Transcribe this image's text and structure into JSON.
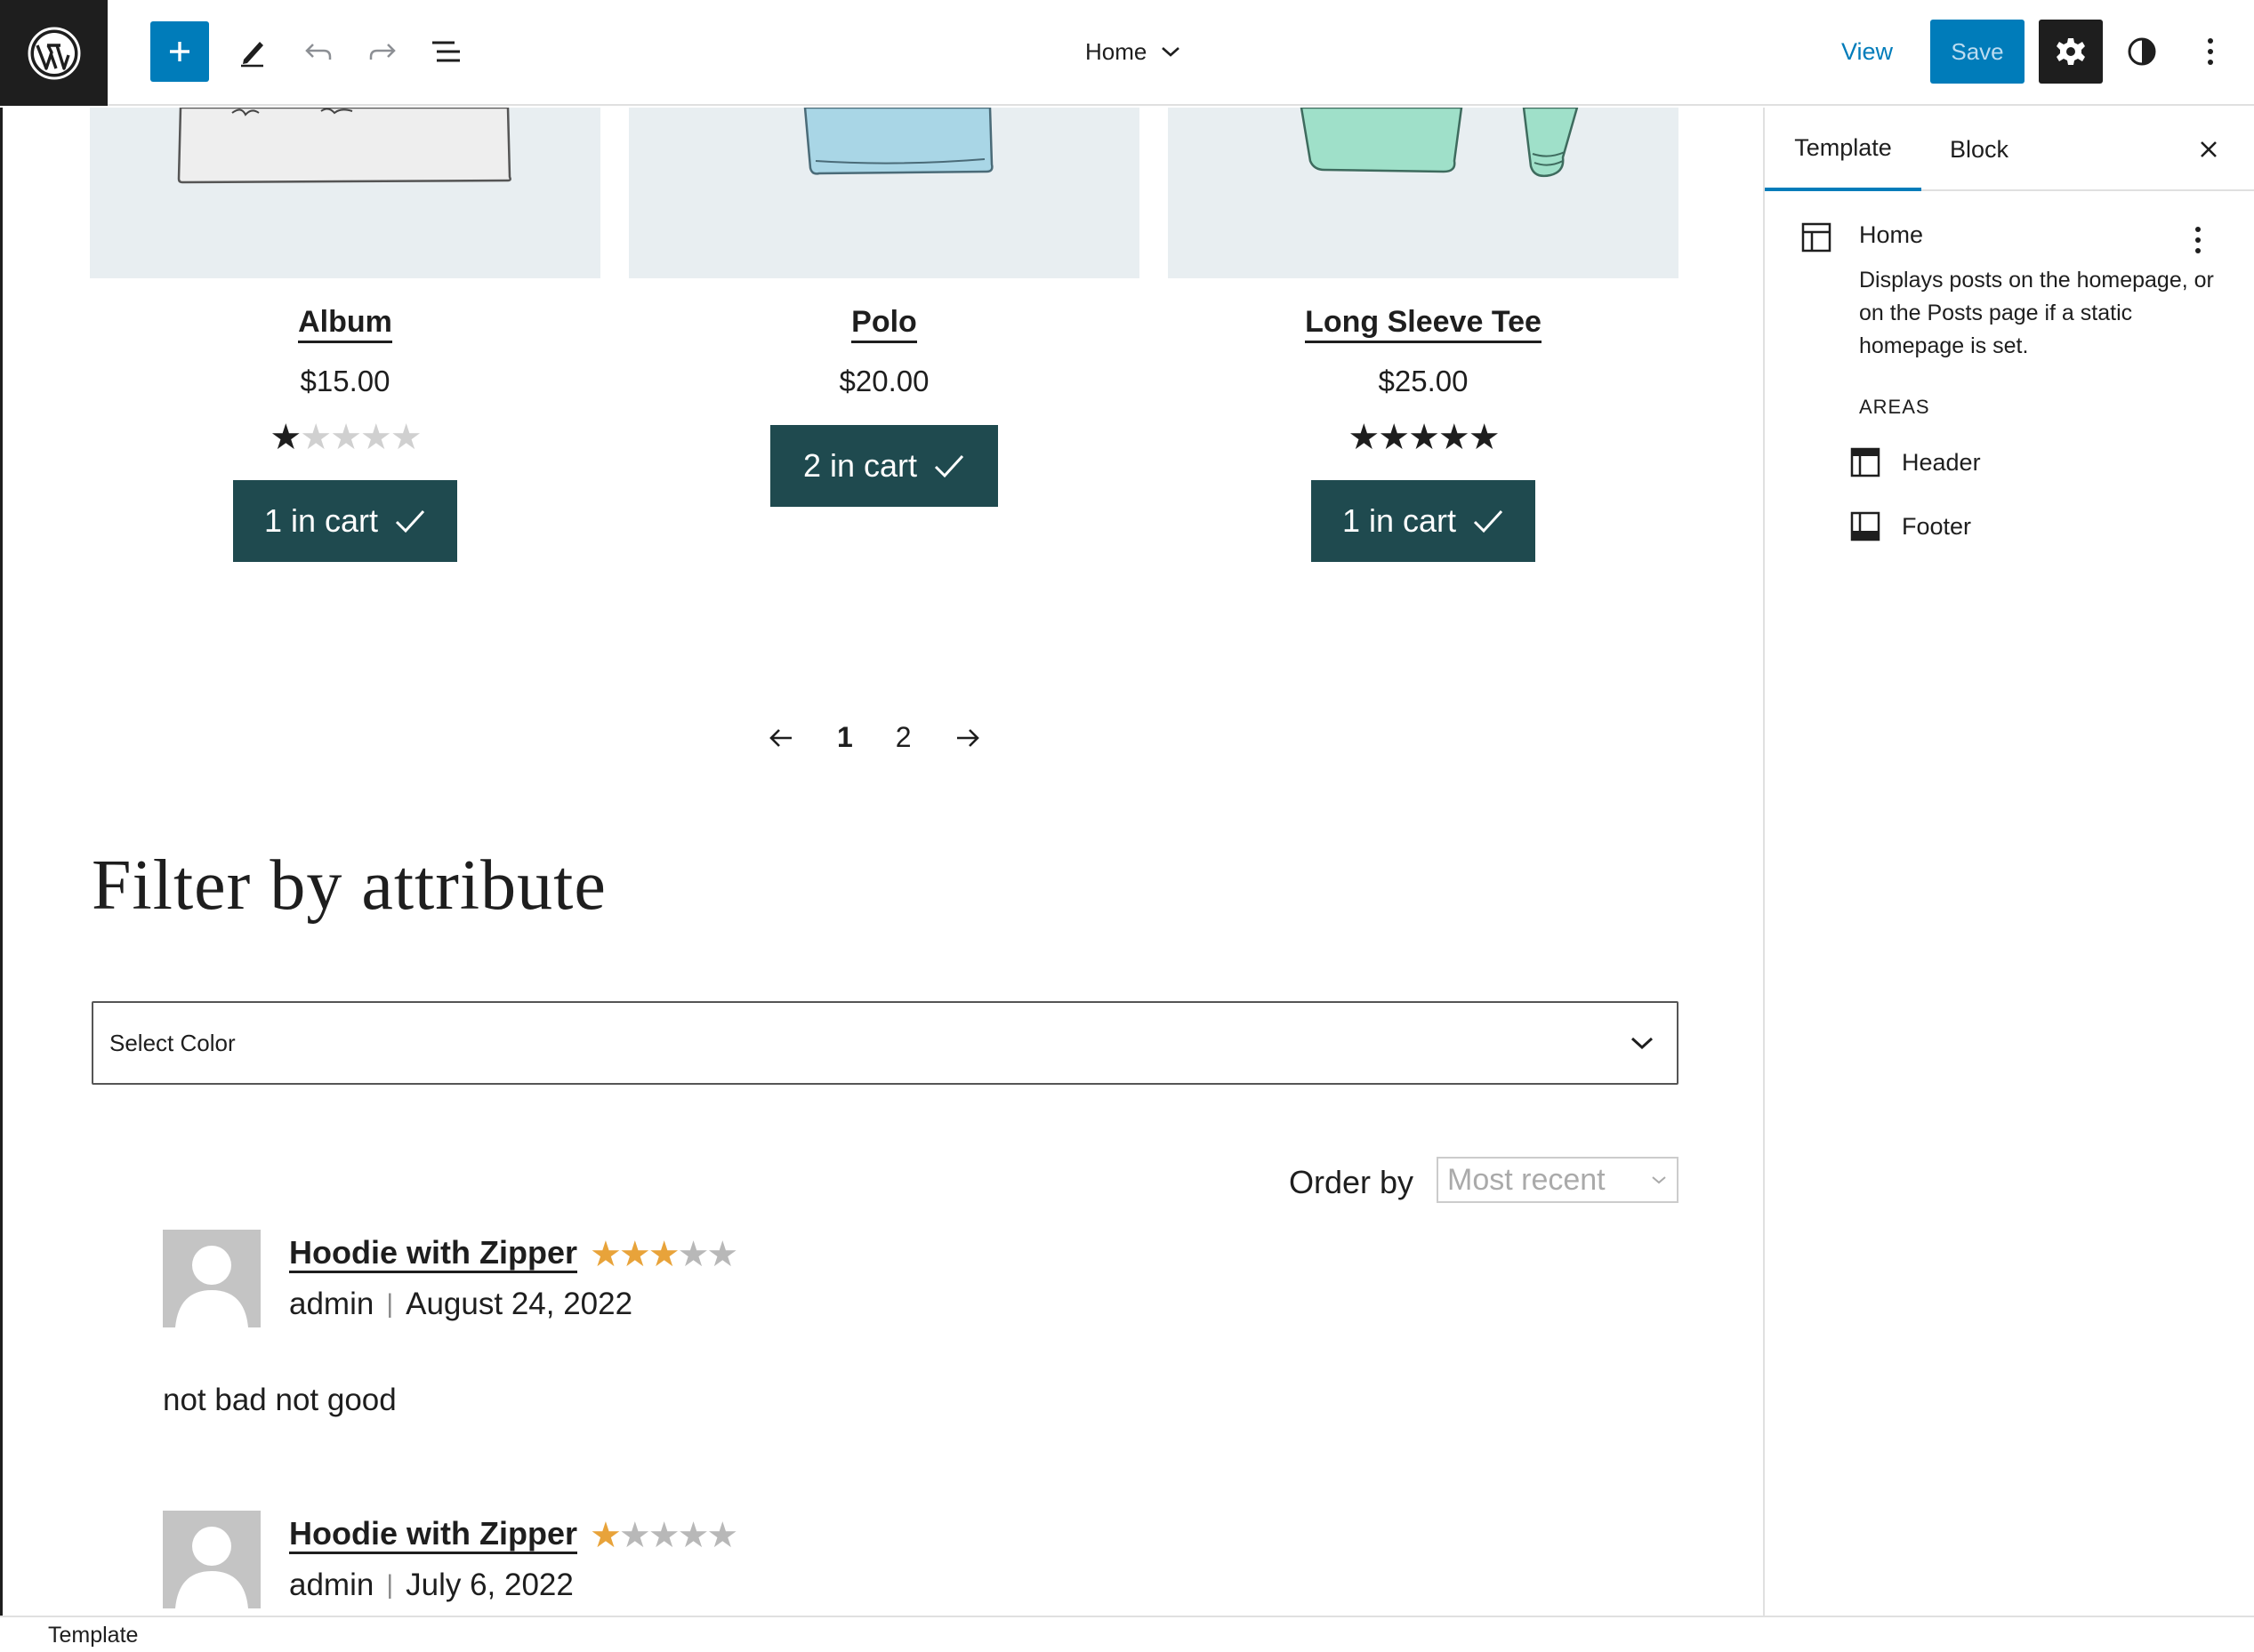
{
  "toolbar": {
    "document_title": "Home",
    "view_label": "View",
    "save_label": "Save"
  },
  "products": [
    {
      "name": "Album",
      "price": "$15.00",
      "rating": 1,
      "cart_label": "1 in cart"
    },
    {
      "name": "Polo",
      "price": "$20.00",
      "rating": null,
      "cart_label": "2 in cart"
    },
    {
      "name": "Long Sleeve Tee",
      "price": "$25.00",
      "rating": 5,
      "cart_label": "1 in cart"
    }
  ],
  "pagination": {
    "current": "1",
    "next": "2"
  },
  "filter": {
    "title": "Filter by attribute",
    "select_placeholder": "Select Color"
  },
  "order": {
    "label": "Order by",
    "selected": "Most recent"
  },
  "reviews": [
    {
      "product": "Hoodie with Zipper",
      "rating": 3,
      "author": "admin",
      "date": "August 24, 2022",
      "text": "not bad not good"
    },
    {
      "product": "Hoodie with Zipper",
      "rating": 1,
      "author": "admin",
      "date": "July 6, 2022",
      "text": ""
    }
  ],
  "sidebar": {
    "tabs": [
      "Template",
      "Block"
    ],
    "template_title": "Home",
    "template_description": "Displays posts on the homepage, or on the Posts page if a static homepage is set.",
    "areas_heading": "AREAS",
    "areas": [
      {
        "label": "Header",
        "icon": "header-area-icon"
      },
      {
        "label": "Footer",
        "icon": "footer-area-icon"
      }
    ]
  },
  "footer": {
    "breadcrumb": "Template"
  },
  "colors": {
    "accent": "#007cba",
    "cart_button": "#1f4a4f",
    "star_gold": "#e8a33a"
  }
}
